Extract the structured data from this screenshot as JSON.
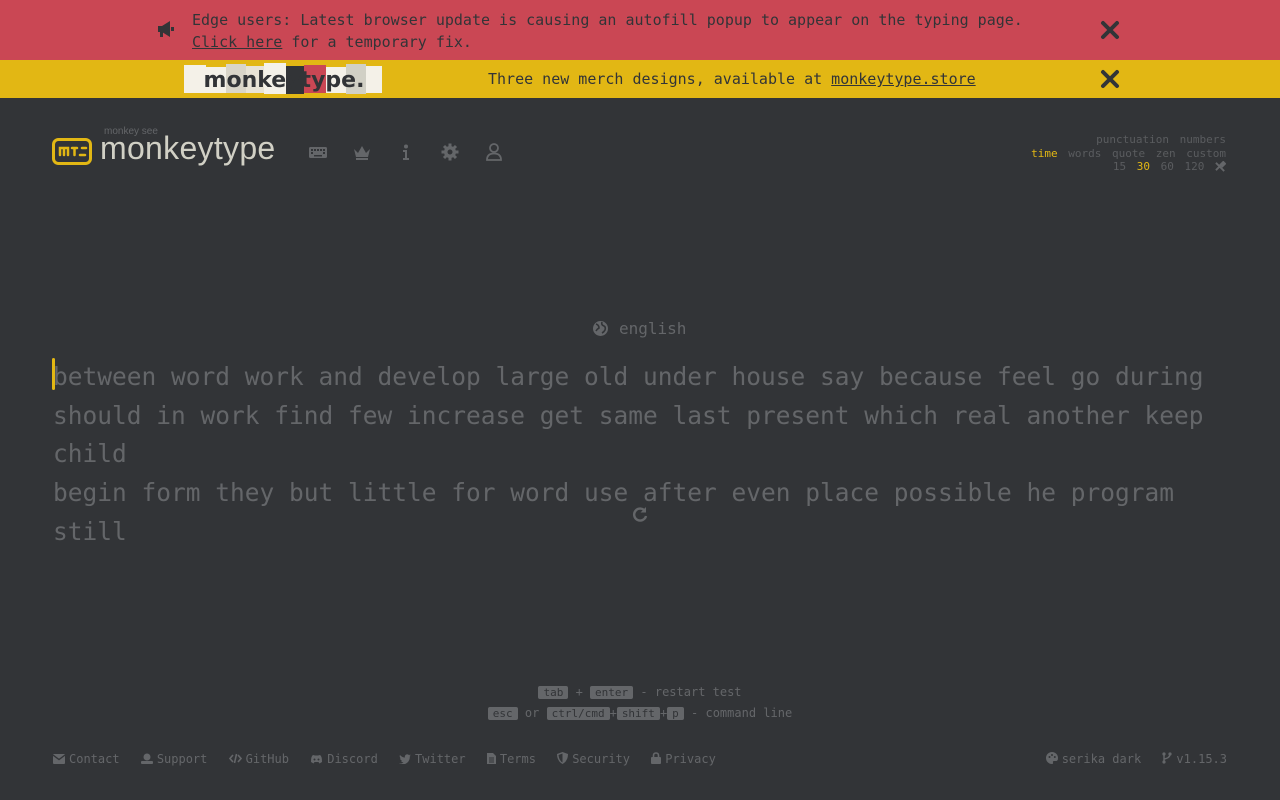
{
  "banners": {
    "alert": {
      "text_before": "Edge users: Latest browser update is causing an autofill popup to appear on the typing page.",
      "link": "Click here",
      "text_after": " for a temporary fix."
    },
    "merch": {
      "logo_text": "monkeytype.",
      "text": "Three new merch designs, available at ",
      "link": "monkeytype.store"
    }
  },
  "header": {
    "subtitle": "monkey see",
    "title": "monkeytype",
    "nav": [
      "keyboard-icon",
      "crown-icon",
      "info-icon",
      "gear-icon",
      "user-icon"
    ]
  },
  "config": {
    "row1": [
      "punctuation",
      "numbers"
    ],
    "row2": [
      "time",
      "words",
      "quote",
      "zen",
      "custom"
    ],
    "row2_active": "time",
    "row3": [
      "15",
      "30",
      "60",
      "120"
    ],
    "row3_active": "30"
  },
  "test": {
    "language": "english",
    "lines": [
      "between word work and develop large old under house say because feel go during",
      "should in work find few increase get same last present which real another keep child",
      "begin form they but little for word use after even place possible he program still"
    ]
  },
  "hints": {
    "line1": {
      "key1": "tab",
      "plus": "+",
      "key2": "enter",
      "text": "- restart test"
    },
    "line2": {
      "key1": "esc",
      "or": "or",
      "key2": "ctrl/cmd",
      "plus1": "+",
      "key3": "shift",
      "plus2": "+",
      "key4": "p",
      "text": "- command line"
    }
  },
  "footer": {
    "links": [
      "Contact",
      "Support",
      "GitHub",
      "Discord",
      "Twitter",
      "Terms",
      "Security",
      "Privacy"
    ],
    "theme": "serika dark",
    "version": "v1.15.3"
  },
  "colors": {
    "background": "#323437",
    "main": "#e2b714",
    "text": "#d1d0c5",
    "sub": "#646669",
    "alert": "#ca4754"
  }
}
